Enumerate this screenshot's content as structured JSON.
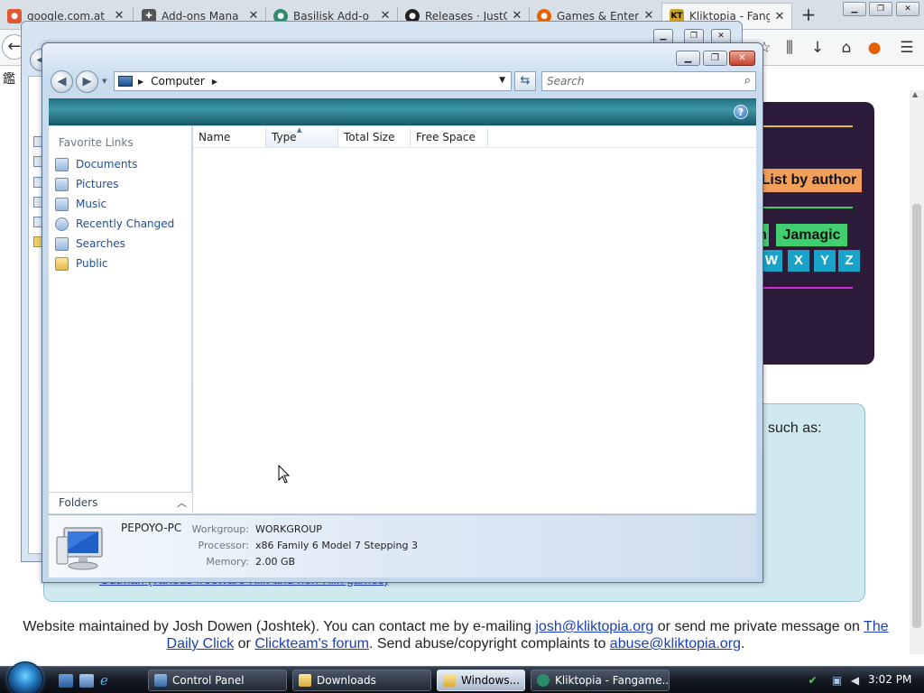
{
  "browser": {
    "tabs": [
      {
        "label": "google.com.at",
        "favicon": "duckduckgo-icon",
        "color": "#de5833"
      },
      {
        "label": "Add-ons Mana",
        "favicon": "puzzle-icon",
        "color": "#555555"
      },
      {
        "label": "Basilisk Add-o",
        "favicon": "basilisk-icon",
        "color": "#2a8c6a"
      },
      {
        "label": "Releases · JustO",
        "favicon": "github-icon",
        "color": "#222222"
      },
      {
        "label": "Games & Enter",
        "favicon": "firefox-icon",
        "color": "#e66000"
      },
      {
        "label": "Kliktopia - Fang",
        "favicon": "kliktopia-icon",
        "color": "#c9a227"
      }
    ],
    "close_glyph": "✕",
    "new_tab_glyph": "+",
    "bookmark_text": "鑑"
  },
  "webpage": {
    "list_by_author": "List by author",
    "author_partial": "n",
    "author_jamagic": "Jamagic",
    "letters": [
      "W",
      "X",
      "Y",
      "Z"
    ],
    "such_as": "such as:",
    "partial_link": "Gutman (various freeware Klik and non-Klik games)",
    "footer": {
      "text1": "Website maintained by Josh Dowen (Joshtek). You can contact me by e-mailing ",
      "email1": "josh@kliktopia.org",
      "text2": " or send me private message on ",
      "link_daily": "The Daily Click",
      "text3": " or ",
      "link_forum": "Clickteam's forum",
      "text4": ". Send abuse/copyright complaints to ",
      "email2": "abuse@kliktopia.org",
      "text5": "."
    },
    "colors": {
      "purple_bg": "#2d1b3a",
      "orange": "#f29f5c",
      "green": "#3fcf6f",
      "cyan_letter": "#1aa3c9",
      "cyan_box": "#cfe9ef"
    }
  },
  "explorer": {
    "address_path": "Computer",
    "search_placeholder": "Search",
    "help_glyph": "?",
    "favorite_links_title": "Favorite Links",
    "favorite_links": [
      "Documents",
      "Pictures",
      "Music",
      "Recently Changed",
      "Searches",
      "Public"
    ],
    "folders_label": "Folders",
    "columns": [
      "Name",
      "Type",
      "Total Size",
      "Free Space"
    ],
    "sorted_column": "Type",
    "computer_name": "PEPOYO-PC",
    "workgroup_label": "Workgroup:",
    "workgroup_value": "WORKGROUP",
    "processor_label": "Processor:",
    "processor_value": "x86 Family 6 Model 7 Stepping 3",
    "memory_label": "Memory:",
    "memory_value": "2.00 GB"
  },
  "taskbar": {
    "buttons": [
      {
        "label": "Control Panel",
        "icon": "control-panel-icon",
        "active": false
      },
      {
        "label": "Downloads",
        "icon": "folder-icon",
        "active": false
      },
      {
        "label": "Windows...",
        "icon": "folder-icon",
        "active": true
      },
      {
        "label": "Kliktopia - Fangame...",
        "icon": "basilisk-icon",
        "active": false
      }
    ],
    "clock": "3:02 PM"
  }
}
